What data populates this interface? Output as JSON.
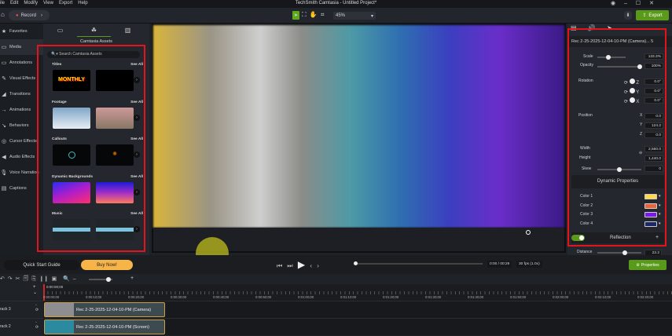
{
  "menu": [
    "ile",
    "Edit",
    "Modify",
    "View",
    "Export",
    "Help"
  ],
  "window_title": "TechSmith Camtasia - Untitled Project*",
  "toolbar": {
    "record": "Record",
    "zoom": "45%",
    "export": "Export"
  },
  "sidebar": [
    "Favorites",
    "Media",
    "Annotations",
    "Visual Effects",
    "Transitions",
    "Animations",
    "Behaviors",
    "Cursor Effects",
    "Audio Effects",
    "Voice Narration",
    "Captions"
  ],
  "assets": {
    "header": "Camtasia Assets",
    "search_placeholder": "Search Camtasia Assets",
    "see_all": "See All",
    "sections": [
      {
        "title": "Titles",
        "thumb_text": "MONTHLY"
      },
      {
        "title": "Footage"
      },
      {
        "title": "Callouts"
      },
      {
        "title": "Dynamic Backgrounds"
      },
      {
        "title": "Music"
      }
    ]
  },
  "properties": {
    "clip_name": "Rec 2-25-2025-12-04-10-PM (Camera)... 5",
    "scale_label": "Scale",
    "scale": "133.3%",
    "scale_fraction": 0.4,
    "opacity_label": "Opacity",
    "opacity": "100%",
    "rotation_label": "Rotation",
    "rot_z": "0.0°",
    "rot_y": "0.0°",
    "rot_x": "0.0°",
    "position_label": "Position",
    "pos_x": "0.0",
    "pos_y": "124.2",
    "pos_z": "0.0",
    "width_label": "Width",
    "width": "2,560.0",
    "height_label": "Height",
    "height": "1,440.0",
    "skew_label": "Skew",
    "skew": "0",
    "dynamic_header": "Dynamic Properties",
    "colors": [
      {
        "label": "Color 1",
        "hex": "#ffd94a"
      },
      {
        "label": "Color 2",
        "hex": "#e8643a"
      },
      {
        "label": "Color 3",
        "hex": "#7a18ee"
      },
      {
        "label": "Color 4",
        "hex": "#1b2868"
      }
    ],
    "reflection": "Reflection",
    "distance_label": "Distance",
    "distance": "22.2"
  },
  "playback": {
    "quick_start": "Quick Start Guide",
    "buy": "Buy Now!",
    "time": "0:00 / 00:29",
    "fps": "30 fps (1.0x)",
    "properties": "Properties"
  },
  "timeline": {
    "playhead": "0:00:00;00",
    "ticks": [
      "0:00:00;00",
      "0:00:10;00",
      "0:00:20;00",
      "0:00:30;00",
      "0:00:40;00",
      "0:00:50;00",
      "0:01:00;00",
      "0:01:10;00",
      "0:01:20;00",
      "0:01:30;00",
      "0:01:40;00",
      "0:01:50;00",
      "0:02:00;00",
      "0:02:10;00",
      "0:02:20;00"
    ],
    "tracks": [
      {
        "name": "rack 3",
        "clip": "Rec 2-25-2025-12-04-10-PM (Camera)"
      },
      {
        "name": "rack 2",
        "clip": "Rec 2-25-2025-12-04-10-PM (Screen)"
      }
    ]
  },
  "accent": "#5a9a1a"
}
